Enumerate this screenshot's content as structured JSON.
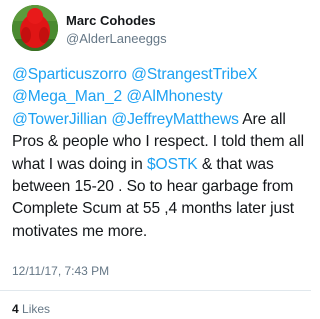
{
  "author": {
    "display_name": "Marc Cohodes",
    "handle": "@AlderLaneeggs",
    "avatar_icon": "avatar-red-figure-icon"
  },
  "tweet": {
    "mentions": [
      "@Sparticuszorro",
      "@StrangestTribeX",
      "@Mega_Man_2",
      "@AlMhonesty",
      "@TowerJillian",
      "@JeffreyMatthews"
    ],
    "text_part1": "Are all Pros & people who I respect. I told them all what I was doing in",
    "cashtag": "$OSTK",
    "text_part2": "& that was between 15-20 . So to hear garbage from Complete Scum at 55 ,4 months later just motivates me more.",
    "timestamp": "12/11/17, 7:43 PM"
  },
  "stats": {
    "likes_count": "4",
    "likes_label": "Likes"
  },
  "colors": {
    "link": "#1da1f2",
    "text": "#14171a",
    "muted": "#657786"
  }
}
